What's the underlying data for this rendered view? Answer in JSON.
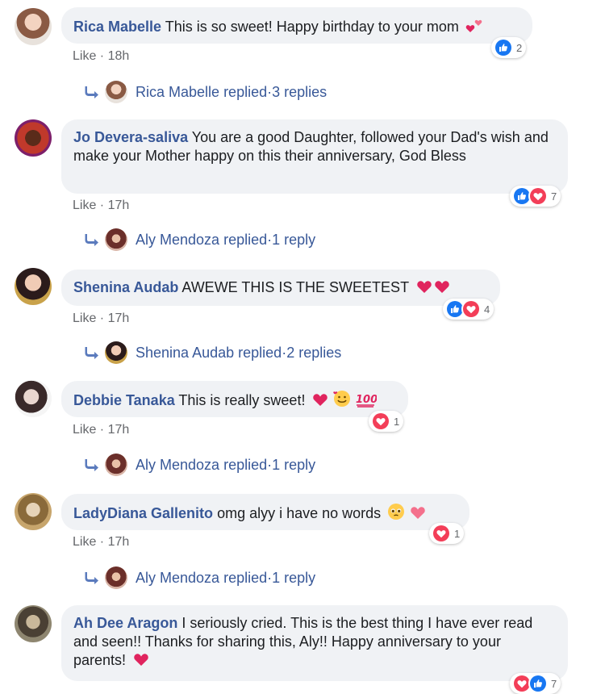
{
  "comments": [
    {
      "author": "Rica Mabelle",
      "text": "This is so sweet! Happy birthday to your mom",
      "reaction_count": "2",
      "reactions": [
        "like-icon"
      ],
      "like_label": "Like",
      "separator": " · ",
      "time": "18h",
      "replies": {
        "name": "Rica Mabelle",
        "action": "replied",
        "separator": " · ",
        "count": "3 replies"
      }
    },
    {
      "author": "Jo Devera-saliva",
      "text": "You are a good Daughter, followed your Dad's wish and make your Mother happy on this their anniversary, God Bless",
      "reaction_count": "7",
      "reactions": [
        "like-icon",
        "love-icon"
      ],
      "like_label": "Like",
      "separator": " · ",
      "time": "17h",
      "replies": {
        "name": "Aly Mendoza",
        "action": "replied",
        "separator": " · ",
        "count": "1 reply"
      }
    },
    {
      "author": "Shenina Audab",
      "text": "AWEWE THIS IS THE SWEETEST",
      "reaction_count": "4",
      "reactions": [
        "like-icon",
        "love-icon"
      ],
      "like_label": "Like",
      "separator": " · ",
      "time": "17h",
      "replies": {
        "name": "Shenina Audab",
        "action": "replied",
        "separator": " · ",
        "count": "2 replies"
      }
    },
    {
      "author": "Debbie Tanaka",
      "text": "This is really sweet!",
      "reaction_count": "1",
      "reactions": [
        "love-icon"
      ],
      "like_label": "Like",
      "separator": " · ",
      "time": "17h",
      "replies": {
        "name": "Aly Mendoza",
        "action": "replied",
        "separator": " · ",
        "count": "1 reply"
      }
    },
    {
      "author": "LadyDiana Gallenito",
      "text": "omg alyy i have no words",
      "reaction_count": "1",
      "reactions": [
        "love-icon"
      ],
      "like_label": "Like",
      "separator": " · ",
      "time": "17h",
      "replies": {
        "name": "Aly Mendoza",
        "action": "replied",
        "separator": " · ",
        "count": "1 reply"
      }
    },
    {
      "author": "Ah Dee Aragon",
      "text": "I seriously cried. This is the best thing I have ever read and seen!! Thanks for sharing this, Aly!! Happy anniversary to your parents!",
      "reaction_count": "7",
      "reactions": [
        "love-icon",
        "like-icon"
      ]
    }
  ],
  "colors": {
    "author": "#385898",
    "bubble": "#f0f2f5",
    "meta": "#65676b",
    "like_blue": "#1877f2",
    "love_red": "#f33e58"
  }
}
